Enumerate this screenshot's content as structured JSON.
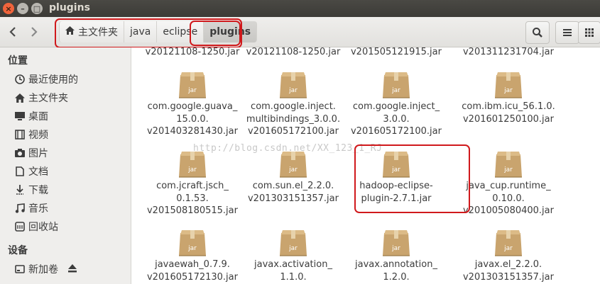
{
  "window": {
    "title": "plugins"
  },
  "breadcrumb": [
    "主文件夹",
    "java",
    "eclipse",
    "plugins"
  ],
  "icons": {
    "back": "chevron-left-icon",
    "forward": "chevron-right-icon",
    "home": "home-icon",
    "search": "search-icon",
    "list_view": "list-view-icon",
    "grid_view": "grid-view-icon"
  },
  "sidebar": {
    "sections": [
      {
        "heading": "位置",
        "items": [
          {
            "label": "最近使用的",
            "icon": "clock-icon"
          },
          {
            "label": "主文件夹",
            "icon": "home-icon"
          },
          {
            "label": "桌面",
            "icon": "desktop-icon"
          },
          {
            "label": "视频",
            "icon": "video-icon"
          },
          {
            "label": "图片",
            "icon": "camera-icon"
          },
          {
            "label": "文档",
            "icon": "document-icon"
          },
          {
            "label": "下载",
            "icon": "download-icon"
          },
          {
            "label": "音乐",
            "icon": "music-icon"
          },
          {
            "label": "回收站",
            "icon": "trash-icon"
          }
        ]
      },
      {
        "heading": "设备",
        "items": [
          {
            "label": "新加卷",
            "icon": "drive-icon"
          }
        ]
      }
    ]
  },
  "files": {
    "row0": [
      "v20121108-1250.jar",
      "v20121108-1250.jar",
      "v201505121915.jar",
      "v201311231704.jar"
    ],
    "row1": [
      [
        "com.google.guava_",
        "15.0.0.",
        "v201403281430.jar"
      ],
      [
        "com.google.inject.",
        "multibindings_3.0.0.",
        "v201605172100.jar"
      ],
      [
        "com.google.inject_",
        "3.0.0.",
        "v201605172100.jar"
      ],
      [
        "com.ibm.icu_56.1.0.",
        "v201601250100.jar"
      ]
    ],
    "row2": [
      [
        "com.jcraft.jsch_",
        "0.1.53.",
        "v201508180515.jar"
      ],
      [
        "com.sun.el_2.2.0.",
        "v201303151357.jar"
      ],
      [
        "hadoop-eclipse-",
        "plugin-2.7.1.jar"
      ],
      [
        "java_cup.runtime_",
        "0.10.0.",
        "v201005080400.jar"
      ]
    ],
    "row3": [
      [
        "javaewah_0.7.9.",
        "v201605172130.jar"
      ],
      [
        "javax.activation_",
        "1.1.0."
      ],
      [
        "javax.annotation_",
        "1.2.0."
      ],
      [
        "javax.el_2.2.0.",
        "v201303151357.jar"
      ]
    ],
    "jar_label": "jar"
  },
  "watermark": "http://blog.csdn.net/XX_123_1_RJ",
  "colors": {
    "highlight_border": "#d0191c",
    "titlebar": "#3c3b37",
    "sidebar_bg": "#efeeec"
  }
}
